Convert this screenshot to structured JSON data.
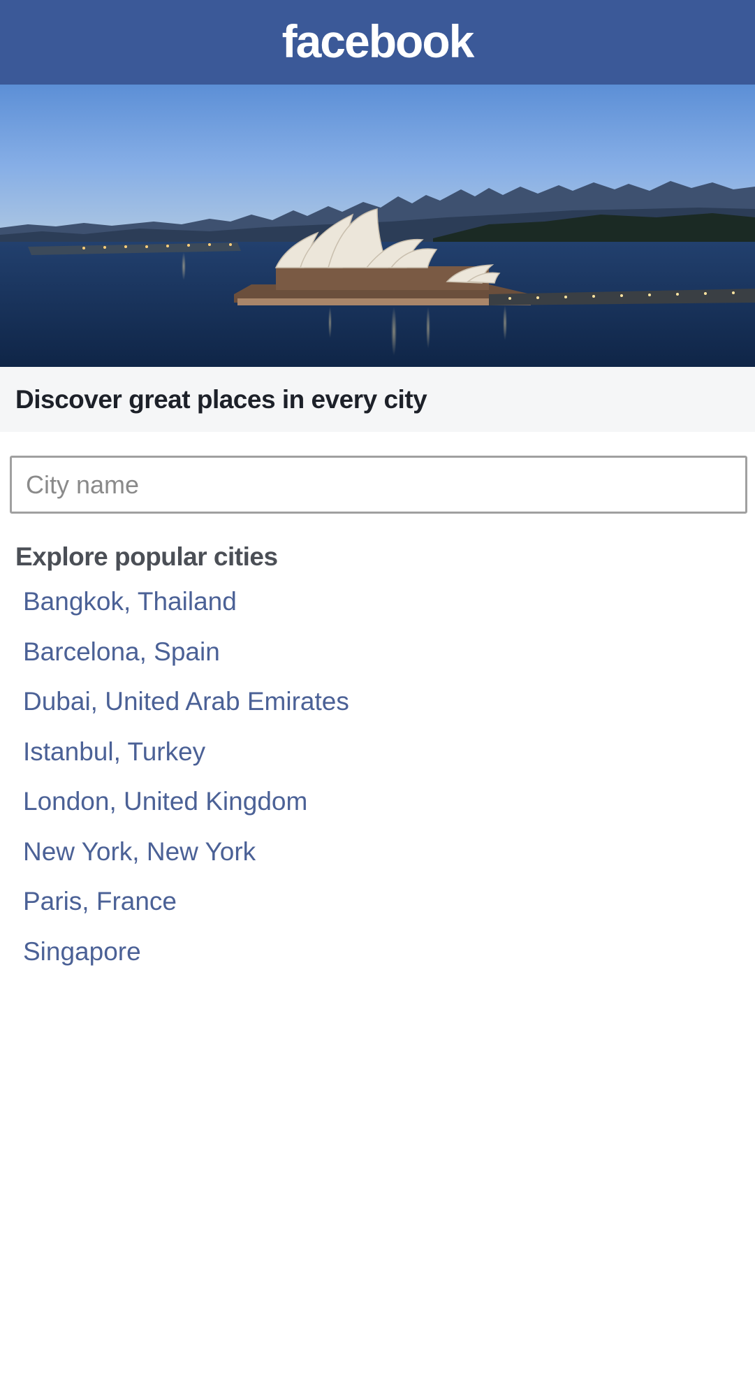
{
  "header": {
    "logo_text": "facebook",
    "background_color": "#3b5998"
  },
  "hero": {
    "image_description_icon": "sydney-opera-house-photo"
  },
  "tagline": "Discover great places in every city",
  "search": {
    "placeholder": "City name",
    "value": ""
  },
  "explore": {
    "title": "Explore popular cities",
    "cities": [
      "Bangkok, Thailand",
      "Barcelona, Spain",
      "Dubai, United Arab Emirates",
      "Istanbul, Turkey",
      "London, United Kingdom",
      "New York, New York",
      "Paris, France",
      "Singapore"
    ],
    "link_color": "#4b6196"
  }
}
